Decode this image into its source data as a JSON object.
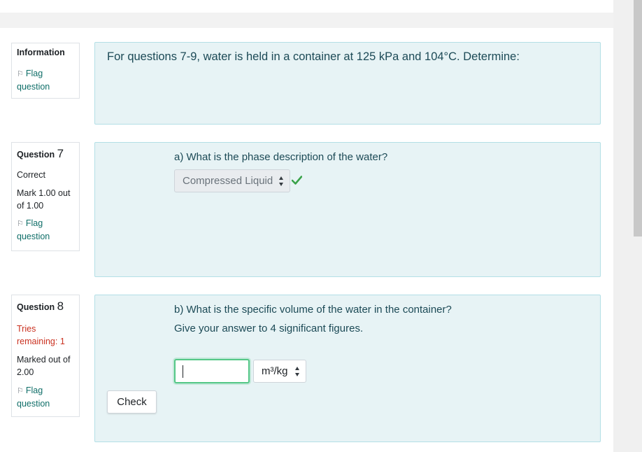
{
  "info": {
    "title": "Information",
    "flag_label": "Flag question",
    "text": "For questions 7-9, water is held in a container at 125 kPa and 104°C. Determine:"
  },
  "q7": {
    "label": "Question",
    "number": "7",
    "state": "Correct",
    "mark": "Mark 1.00 out of 1.00",
    "flag_label": "Flag question",
    "question_text": "a) What is the phase description of the water?",
    "selected_answer": "Compressed Liquid",
    "correct_icon": "check-icon"
  },
  "q8": {
    "label": "Question",
    "number": "8",
    "tries": "Tries remaining: 1",
    "mark": "Marked out of 2.00",
    "flag_label": "Flag question",
    "question_text": "b) What is the specific volume of the water in the container?",
    "instruction": "Give your answer to 4 significant figures.",
    "answer_value": "",
    "unit": "m³/kg",
    "check_label": "Check"
  },
  "colors": {
    "content_bg": "#e7f3f5",
    "content_border": "#b3dfe6",
    "question_text": "#1c4a56",
    "link": "#0f6e68",
    "correct": "#357a32",
    "tries": "#ca3120",
    "input_focus": "#54c787"
  }
}
